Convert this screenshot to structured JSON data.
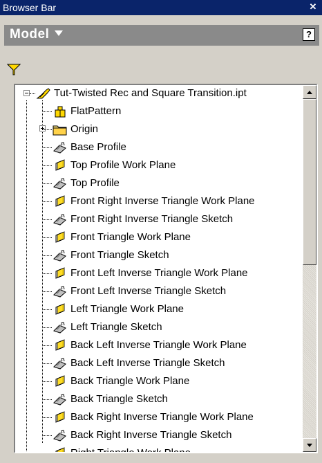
{
  "window": {
    "title": "Browser Bar"
  },
  "model_menu": {
    "label": "Model"
  },
  "tree": {
    "root": "Tut-Twisted Rec and Square Transition.ipt",
    "items": [
      {
        "label": "FlatPattern",
        "icon": "flat-pattern-icon"
      },
      {
        "label": "Origin",
        "icon": "folder-icon"
      },
      {
        "label": "Base Profile",
        "icon": "sketch-icon"
      },
      {
        "label": "Top Profile Work Plane",
        "icon": "work-plane-icon"
      },
      {
        "label": "Top Profile",
        "icon": "sketch-icon"
      },
      {
        "label": "Front Right Inverse Triangle Work Plane",
        "icon": "work-plane-icon"
      },
      {
        "label": "Front Right Inverse Triangle Sketch",
        "icon": "sketch-icon"
      },
      {
        "label": "Front Triangle Work Plane",
        "icon": "work-plane-icon"
      },
      {
        "label": "Front Triangle Sketch",
        "icon": "sketch-icon"
      },
      {
        "label": "Front Left Inverse Triangle Work Plane",
        "icon": "work-plane-icon"
      },
      {
        "label": "Front Left Inverse Triangle Sketch",
        "icon": "sketch-icon"
      },
      {
        "label": "Left Triangle Work Plane",
        "icon": "work-plane-icon"
      },
      {
        "label": "Left Triangle Sketch",
        "icon": "sketch-icon"
      },
      {
        "label": "Back Left Inverse Triangle Work Plane",
        "icon": "work-plane-icon"
      },
      {
        "label": "Back Left Inverse Triangle Sketch",
        "icon": "sketch-icon"
      },
      {
        "label": "Back Triangle Work Plane",
        "icon": "work-plane-icon"
      },
      {
        "label": "Back Triangle Sketch",
        "icon": "sketch-icon"
      },
      {
        "label": "Back Right Inverse Triangle Work Plane",
        "icon": "work-plane-icon"
      },
      {
        "label": "Back Right Inverse Triangle Sketch",
        "icon": "sketch-icon"
      },
      {
        "label": "Right Triangle Work Plane",
        "icon": "work-plane-icon"
      }
    ]
  },
  "colors": {
    "titlebar": "#0a246a",
    "panel": "#d4d0c8",
    "modelbar": "#8a8a8a",
    "filter": "#ffd800"
  }
}
